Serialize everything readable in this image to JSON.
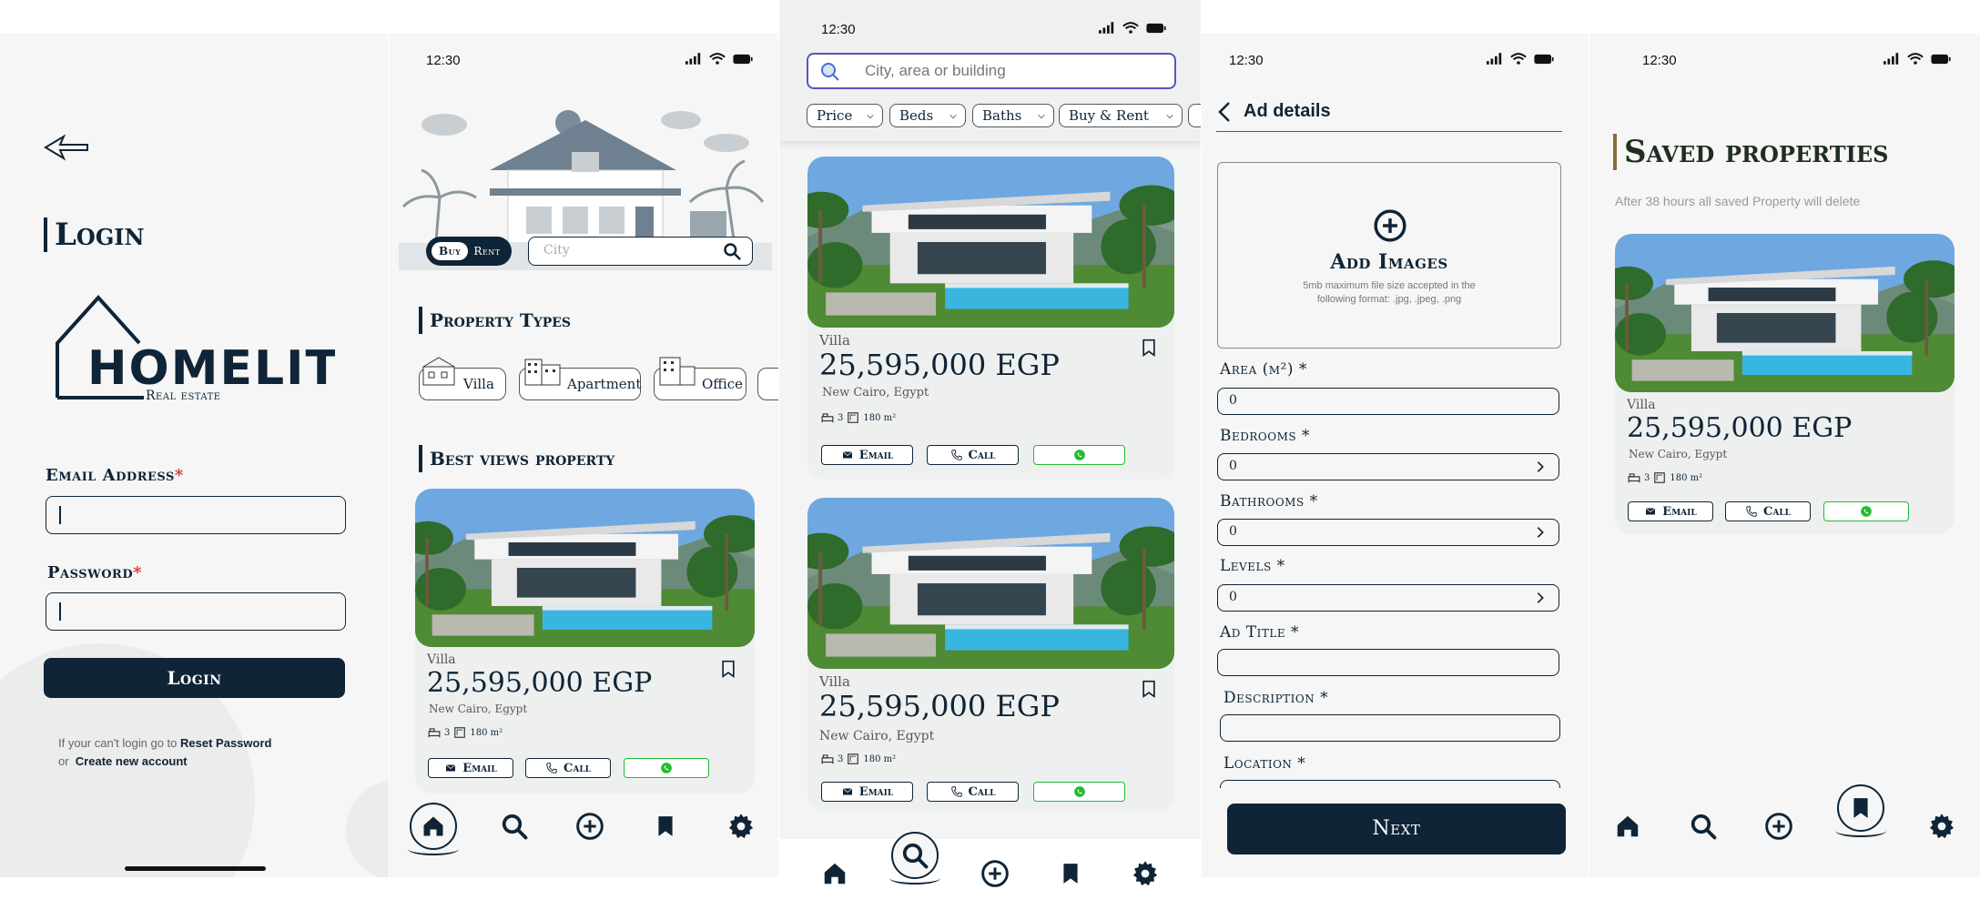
{
  "common": {
    "time": "12:30",
    "type": "Villa",
    "price": "25,595,000 EGP",
    "location": "New Cairo, Egypt",
    "beds": "3",
    "area": "180 m²",
    "email_label": "Email",
    "call_label": "Call"
  },
  "login": {
    "title": "Login",
    "logo_text": "HOMELITE",
    "logo_sub": "Real estate",
    "email_label": "Email Address",
    "password_label": "Password",
    "required": "*",
    "login_button": "Login",
    "help_text": "If your can't login go to",
    "reset_link": "Reset Password",
    "or_text": "or",
    "create_link": "Create new account"
  },
  "home": {
    "buy": "Buy",
    "rent": "Rent",
    "city_placeholder": "City",
    "property_types_title": "Property Types",
    "types": [
      "Villa",
      "Apartment",
      "Office"
    ],
    "best_views_title": "Best views property"
  },
  "search": {
    "placeholder": "City, area or building",
    "filters": [
      "Price",
      "Beds",
      "Baths",
      "Buy & Rent"
    ]
  },
  "ad": {
    "title": "Ad details",
    "add_images": "Add Images",
    "add_images_note": "5mb maximum file size accepted in the following format: .jpg, .jpeg, .png",
    "fields": [
      {
        "label": "Area (m²) *",
        "value": "0"
      },
      {
        "label": "Bedrooms *",
        "value": "0"
      },
      {
        "label": "Bathrooms *",
        "value": "0"
      },
      {
        "label": "Levels *",
        "value": "0"
      },
      {
        "label": "Ad Title *",
        "value": ""
      },
      {
        "label": "Description *",
        "value": ""
      },
      {
        "label": "Location *",
        "value": ""
      }
    ],
    "next_button": "Next"
  },
  "saved": {
    "title": "Saved properties",
    "note": "After 38 hours all saved Property will delete"
  },
  "colors": {
    "primary": "#0f2436",
    "background": "#f5f6f5",
    "whatsapp": "#22bb33",
    "search_accent": "#4a6bd6"
  }
}
